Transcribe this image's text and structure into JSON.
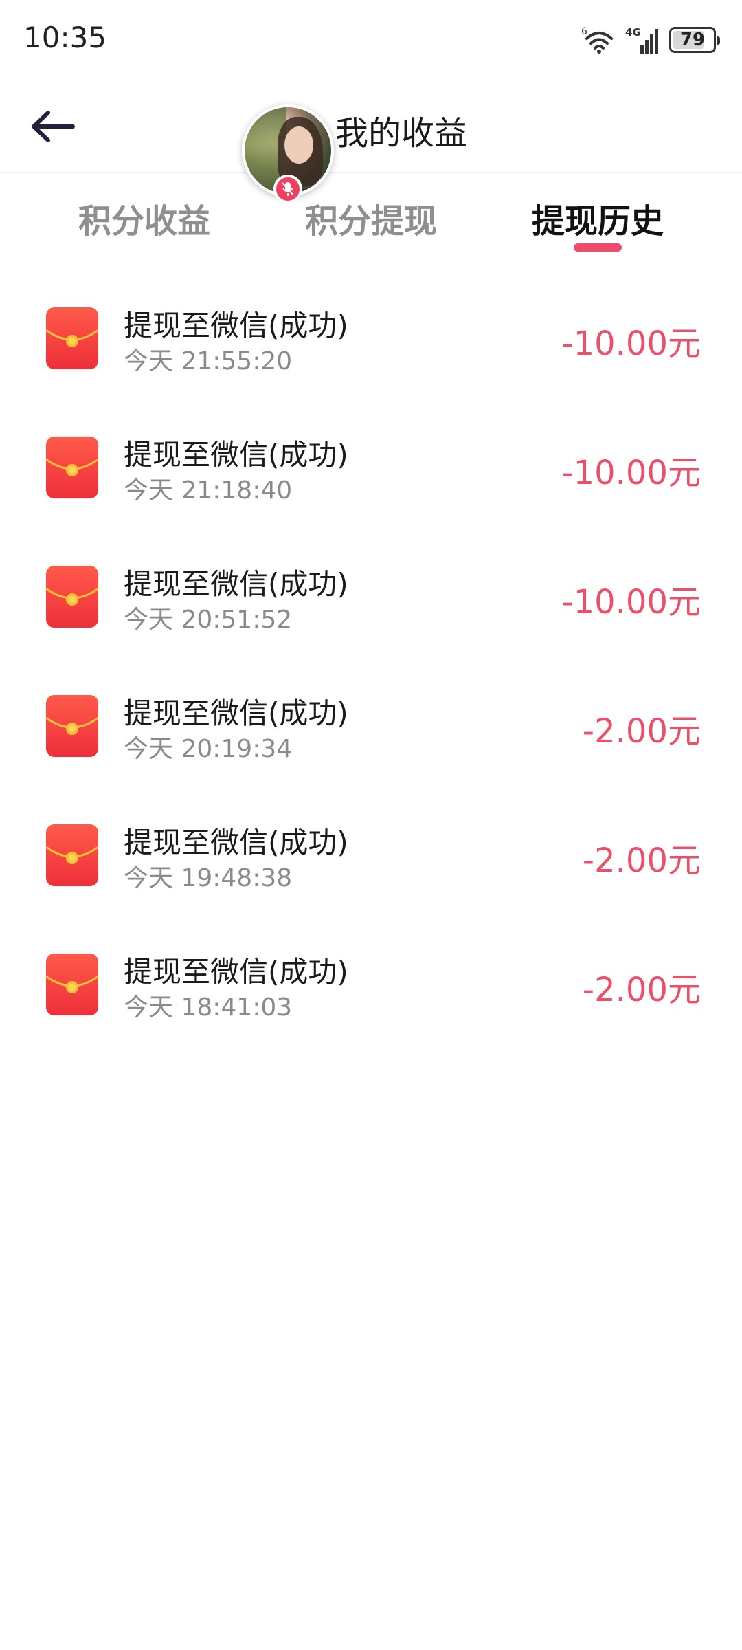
{
  "status_bar": {
    "time": "10:35",
    "battery_level": "79",
    "battery_fraction": 0.79,
    "wifi_label": "6",
    "signal_label": "4G"
  },
  "header": {
    "title": "我的收益",
    "back_icon": "arrow-left-icon"
  },
  "avatar": {
    "badge_icon": "mic-muted-icon"
  },
  "tabs": [
    {
      "label": "积分收益",
      "active": false
    },
    {
      "label": "积分提现",
      "active": false
    },
    {
      "label": "提现历史",
      "active": true
    }
  ],
  "colors": {
    "accent": "#f04a6c",
    "amount": "#ee4f68",
    "envelope": "#f23b3b",
    "envelope_seal": "#f7c136"
  },
  "history": [
    {
      "title": "提现至微信(成功)",
      "time": "今天 21:55:20",
      "amount": "-10.00元",
      "icon": "red-envelope-icon"
    },
    {
      "title": "提现至微信(成功)",
      "time": "今天 21:18:40",
      "amount": "-10.00元",
      "icon": "red-envelope-icon"
    },
    {
      "title": "提现至微信(成功)",
      "time": "今天 20:51:52",
      "amount": "-10.00元",
      "icon": "red-envelope-icon"
    },
    {
      "title": "提现至微信(成功)",
      "time": "今天 20:19:34",
      "amount": "-2.00元",
      "icon": "red-envelope-icon"
    },
    {
      "title": "提现至微信(成功)",
      "time": "今天 19:48:38",
      "amount": "-2.00元",
      "icon": "red-envelope-icon"
    },
    {
      "title": "提现至微信(成功)",
      "time": "今天 18:41:03",
      "amount": "-2.00元",
      "icon": "red-envelope-icon"
    }
  ]
}
